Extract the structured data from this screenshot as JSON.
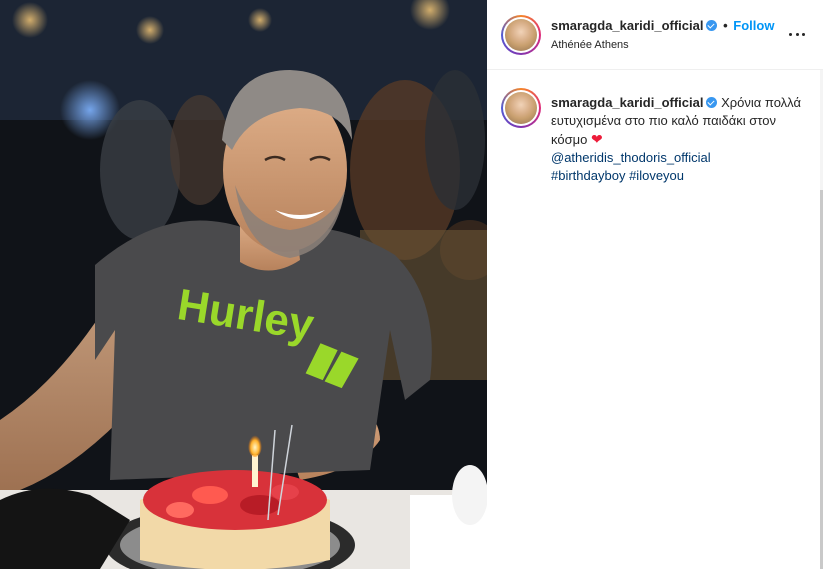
{
  "post": {
    "author": {
      "username": "smaragda_karidi_official",
      "verified": true,
      "location": "Athénée Athens"
    },
    "header": {
      "separator": "•",
      "follow_label": "Follow",
      "more_icon": "more-horizontal-icon"
    },
    "caption": {
      "username": "smaragda_karidi_official",
      "text": "Χρόνια πολλά ευτυχισμένα στο πιο καλό παιδάκι στον κόσμο",
      "emoji": "❤",
      "mention": "@atheridis_thodoris_official",
      "hashtag_1": "#birthdayboy",
      "hashtag_2": "#iloveyou"
    },
    "photo": {
      "shirt_brand_text": "Hurley",
      "shirt_color": "#4a4a4c",
      "logo_color": "#9ad82a"
    }
  },
  "colors": {
    "link": "#00376b",
    "follow": "#0095f6",
    "verified": "#3897f0",
    "heart": "#ed1c3a"
  }
}
